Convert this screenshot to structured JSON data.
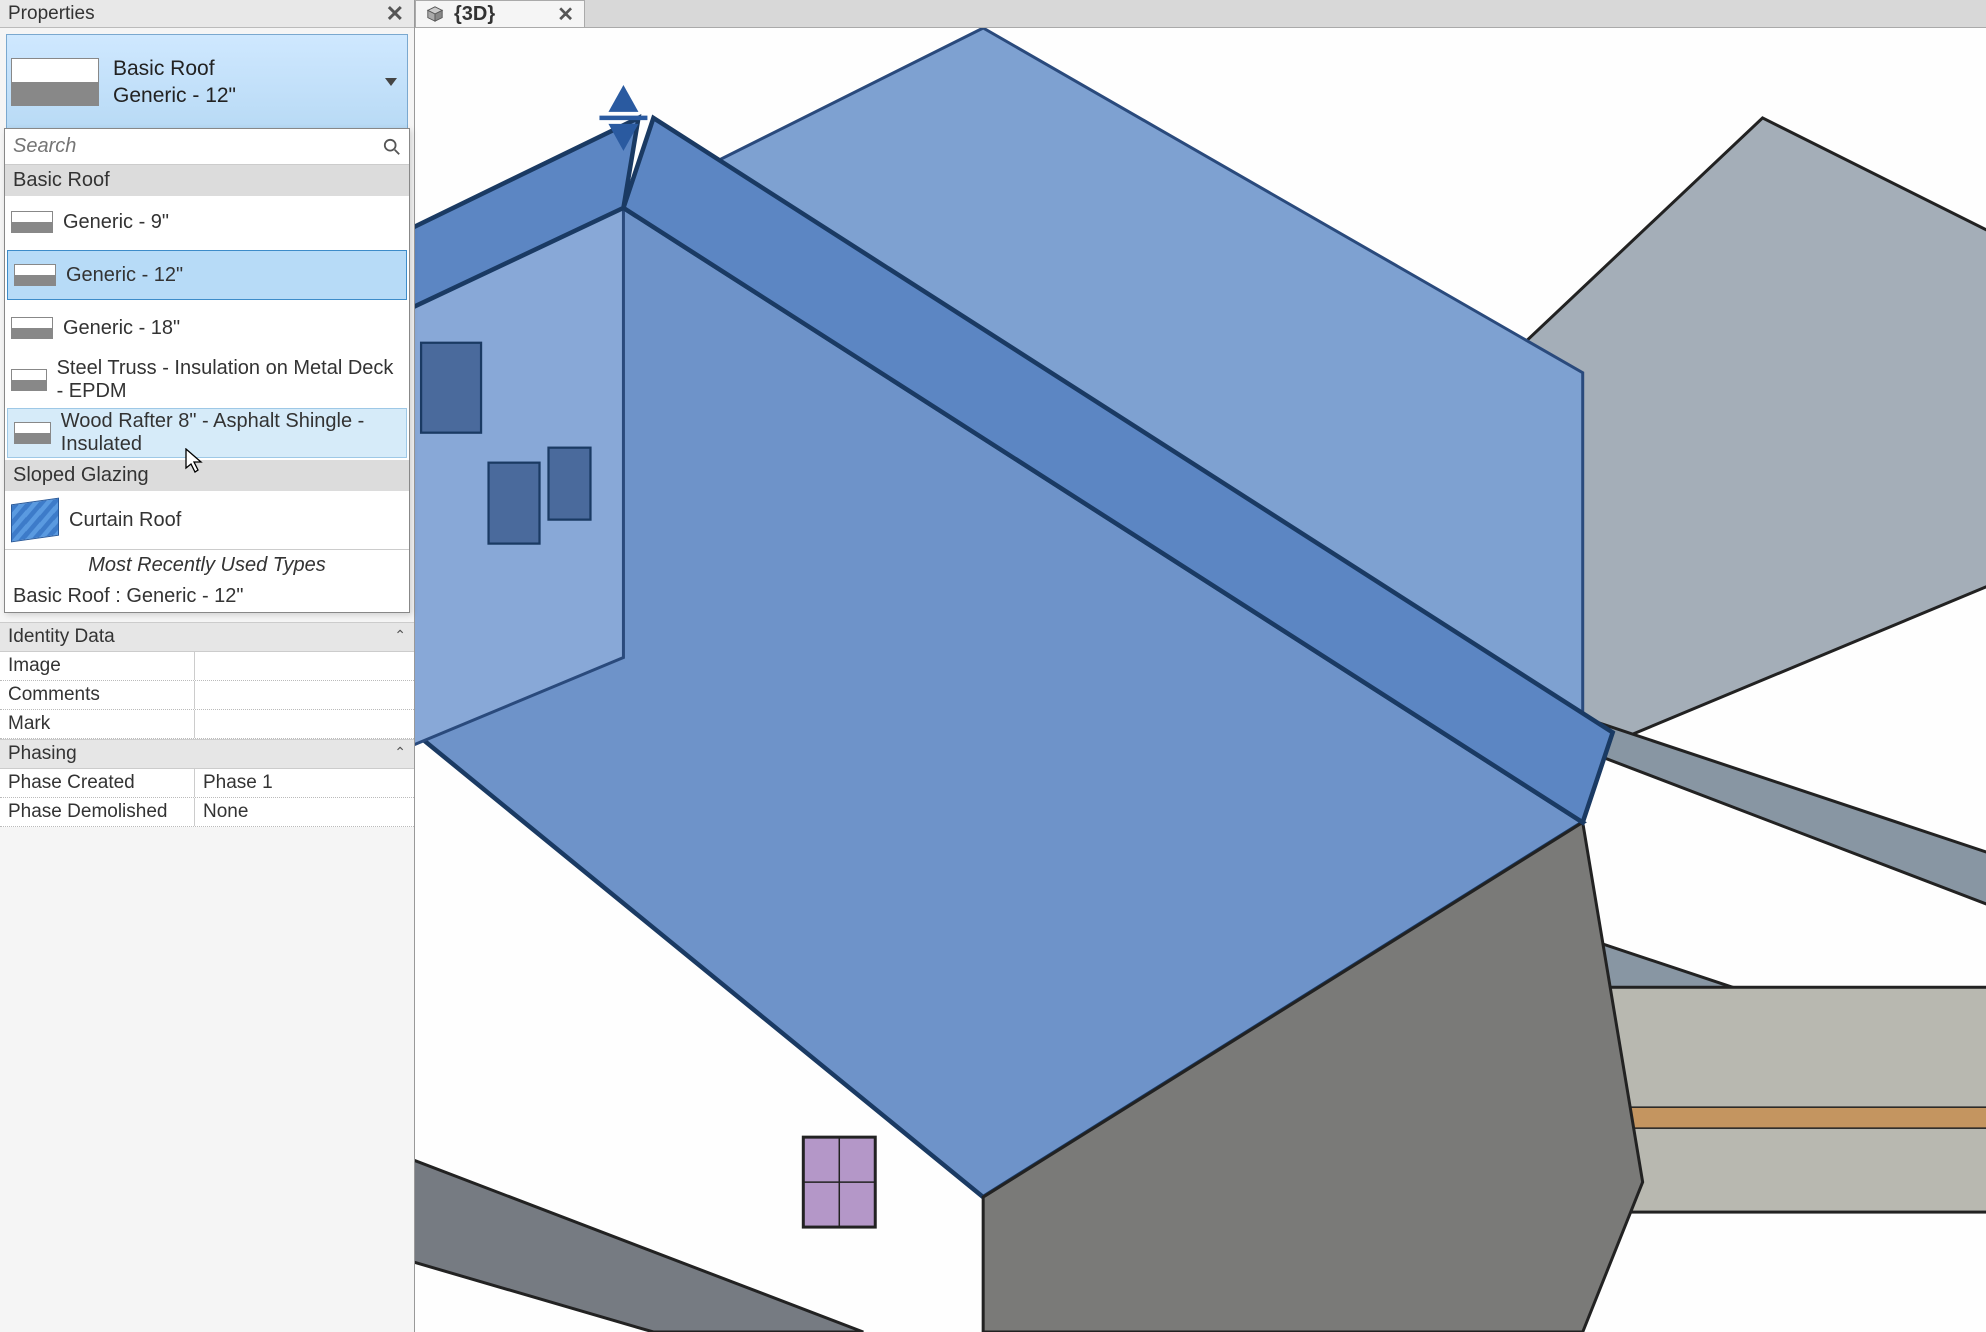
{
  "panel": {
    "title": "Properties",
    "type_family": "Basic Roof",
    "type_name": "Generic - 12\""
  },
  "search": {
    "placeholder": "Search"
  },
  "categories": [
    {
      "name": "Basic Roof",
      "items": [
        {
          "label": "Generic - 9\"",
          "state": ""
        },
        {
          "label": "Generic - 12\"",
          "state": "selected"
        },
        {
          "label": "Generic - 18\"",
          "state": ""
        },
        {
          "label": "Steel Truss - Insulation on Metal Deck - EPDM",
          "state": ""
        },
        {
          "label": "Wood Rafter 8\" - Asphalt Shingle - Insulated",
          "state": "hover"
        }
      ]
    },
    {
      "name": "Sloped Glazing",
      "items": [
        {
          "label": "Curtain Roof",
          "state": "",
          "icon": "curtain"
        }
      ]
    }
  ],
  "mru": {
    "header": "Most Recently Used Types",
    "items": [
      "Basic Roof : Generic - 12\""
    ]
  },
  "grid": {
    "identity_header": "Identity Data",
    "rows1": [
      {
        "label": "Image",
        "value": ""
      },
      {
        "label": "Comments",
        "value": ""
      },
      {
        "label": "Mark",
        "value": ""
      }
    ],
    "phasing_header": "Phasing",
    "rows2": [
      {
        "label": "Phase Created",
        "value": "Phase 1"
      },
      {
        "label": "Phase Demolished",
        "value": "None"
      }
    ]
  },
  "viewtab": {
    "label": "{3D}"
  }
}
